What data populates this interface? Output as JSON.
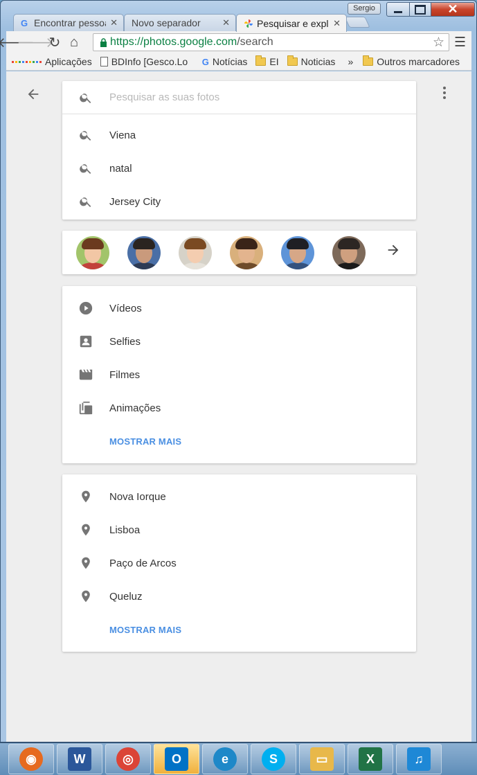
{
  "window": {
    "user": "Sergio"
  },
  "tabs": [
    {
      "title": "Encontrar pessoas",
      "favicon": "google-g-icon",
      "active": false
    },
    {
      "title": "Novo separador",
      "favicon": "",
      "active": false
    },
    {
      "title": "Pesquisar e explorar",
      "favicon": "google-photos-icon",
      "active": true
    }
  ],
  "omnibox": {
    "scheme": "https://",
    "host": "photos.google.com",
    "path": "/search"
  },
  "bookmarks": [
    {
      "label": "Aplicações",
      "icon": "apps-grid-icon"
    },
    {
      "label": "BDInfo [Gesco.Lo",
      "icon": "document-icon"
    },
    {
      "label": "Notícias",
      "icon": "google-g-icon"
    },
    {
      "label": "EI",
      "icon": "folder-icon"
    },
    {
      "label": "Noticias",
      "icon": "folder-icon"
    }
  ],
  "bookmarks_overflow": "»",
  "other_bookmarks": "Outros marcadores",
  "search": {
    "placeholder": "Pesquisar as suas fotos",
    "suggestions": [
      "Viena",
      "natal",
      "Jersey City"
    ]
  },
  "people": {
    "faces": [
      {
        "skin": "#f2c7a5",
        "hair": "#6b3a1e",
        "bg": "#a2c46a",
        "body": "#c2413b"
      },
      {
        "skin": "#c99a7c",
        "hair": "#2a2420",
        "bg": "#4a6fa6",
        "body": "#2d3b55"
      },
      {
        "skin": "#f4cdb0",
        "hair": "#7a4a22",
        "bg": "#d6d2c8",
        "body": "#e6e2da"
      },
      {
        "skin": "#e3b48e",
        "hair": "#3a2418",
        "bg": "#d9b07c",
        "body": "#6f4c2b"
      },
      {
        "skin": "#d6a787",
        "hair": "#1f1f24",
        "bg": "#5e94d8",
        "body": "#34527e"
      },
      {
        "skin": "#cfa07f",
        "hair": "#2c2623",
        "bg": "#7e6a5a",
        "body": "#1a1a1a"
      }
    ]
  },
  "things": {
    "items": [
      {
        "label": "Vídeos",
        "icon": "play-circle-icon"
      },
      {
        "label": "Selfies",
        "icon": "portrait-icon"
      },
      {
        "label": "Filmes",
        "icon": "movie-clapper-icon"
      },
      {
        "label": "Animações",
        "icon": "animation-icon"
      }
    ],
    "more": "MOSTRAR MAIS"
  },
  "places": {
    "items": [
      {
        "label": "Nova Iorque",
        "icon": "place-pin-icon"
      },
      {
        "label": "Lisboa",
        "icon": "place-pin-icon"
      },
      {
        "label": "Paço de Arcos",
        "icon": "place-pin-icon"
      },
      {
        "label": "Queluz",
        "icon": "place-pin-icon"
      }
    ],
    "more": "MOSTRAR MAIS"
  },
  "taskbar": [
    {
      "name": "firefox",
      "icon": "firefox-icon",
      "color": "#e66a1f"
    },
    {
      "name": "word",
      "icon": "word-icon",
      "color": "#2b579a"
    },
    {
      "name": "chrome",
      "icon": "chrome-icon",
      "color": "#db4437"
    },
    {
      "name": "outlook",
      "icon": "outlook-icon",
      "color": "#0072c6"
    },
    {
      "name": "internet-explorer",
      "icon": "ie-icon",
      "color": "#1e88c8"
    },
    {
      "name": "skype",
      "icon": "skype-icon",
      "color": "#00aff0"
    },
    {
      "name": "explorer",
      "icon": "folder-icon",
      "color": "#e8b84a"
    },
    {
      "name": "excel",
      "icon": "excel-icon",
      "color": "#217346"
    },
    {
      "name": "itunes",
      "icon": "music-icon",
      "color": "#1e88d6"
    }
  ],
  "colors": {
    "accent": "#4a8fe2",
    "icon_gray": "#757575"
  }
}
